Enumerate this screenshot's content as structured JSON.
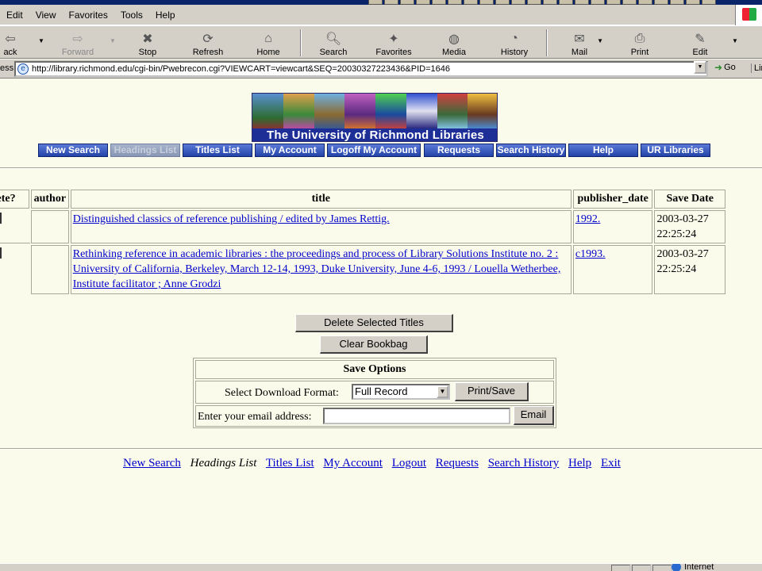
{
  "browser": {
    "menu": [
      "Edit",
      "View",
      "Favorites",
      "Tools",
      "Help"
    ],
    "toolbar": {
      "back": "ack",
      "forward": "Forward",
      "stop": "Stop",
      "refresh": "Refresh",
      "home": "Home",
      "search": "Search",
      "favorites": "Favorites",
      "media": "Media",
      "history": "History",
      "mail": "Mail",
      "print": "Print",
      "edit": "Edit"
    },
    "address_label": "ess",
    "url": "http://library.richmond.edu/cgi-bin/Pwebrecon.cgi?VIEWCART=viewcart&SEQ=20030327223436&PID=1646",
    "go_label": "Go",
    "links_label": "Lin",
    "status_zone": "Internet"
  },
  "banner": {
    "title": "The University of Richmond Libraries"
  },
  "nav": [
    {
      "label": "New Search",
      "enabled": true
    },
    {
      "label": "Headings List",
      "enabled": false
    },
    {
      "label": "Titles List",
      "enabled": true
    },
    {
      "label": "My Account",
      "enabled": true
    },
    {
      "label": "Logoff My Account",
      "enabled": true
    },
    {
      "label": "Requests",
      "enabled": true
    },
    {
      "label": "Search History",
      "enabled": true
    },
    {
      "label": "Help",
      "enabled": true
    },
    {
      "label": "UR Libraries",
      "enabled": true
    }
  ],
  "table": {
    "headers": [
      "Delete?",
      "author",
      "title",
      "publisher_date",
      "Save Date"
    ],
    "rows": [
      {
        "author": "",
        "title": "Distinguished classics of reference publishing / edited by James Rettig.",
        "publisher_date": "1992.",
        "save_date": "2003-03-27 22:25:24"
      },
      {
        "author": "",
        "title": "Rethinking reference in academic libraries : the proceedings and process of Library Solutions Institute no. 2 : University of California, Berkeley, March 12-14, 1993, Duke University, June 4-6, 1993 / Louella Wetherbee, Institute facilitator ; Anne Grodzi",
        "publisher_date": "c1993.",
        "save_date": "2003-03-27 22:25:24"
      }
    ]
  },
  "actions": {
    "delete_selected": "Delete Selected Titles",
    "clear_bookbag": "Clear Bookbag"
  },
  "save_options": {
    "heading": "Save Options",
    "format_label": "Select Download Format:",
    "format_value": "Full Record",
    "print_save": "Print/Save",
    "email_label": "Enter your email address:",
    "email_value": "",
    "email_button": "Email"
  },
  "footer": [
    {
      "label": "New Search",
      "link": true
    },
    {
      "label": "Headings List",
      "link": false
    },
    {
      "label": "Titles List",
      "link": true
    },
    {
      "label": "My Account",
      "link": true
    },
    {
      "label": "Logout",
      "link": true
    },
    {
      "label": "Requests",
      "link": true
    },
    {
      "label": "Search History",
      "link": true
    },
    {
      "label": "Help",
      "link": true
    },
    {
      "label": "Exit",
      "link": true
    }
  ]
}
